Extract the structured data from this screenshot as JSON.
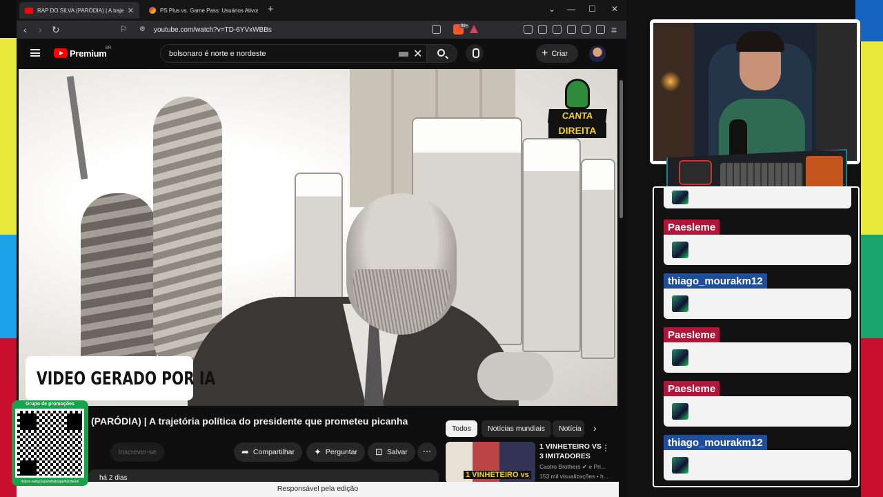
{
  "browser": {
    "tabs": [
      {
        "title": "RAP DO SILVA (PARÓDIA) | A trajetó",
        "active": true
      },
      {
        "title": "PS Plus vs. Game Pass: Usuários Ativos - Goo",
        "active": false
      }
    ],
    "url": "youtube.com/watch?v=TD-6YVxWBBs",
    "extension_badge": "99+",
    "status_text": "Responsável pela edição"
  },
  "youtube": {
    "brand": "Premium",
    "region": "BR",
    "search_query": "bolsonaro é norte e nordeste",
    "create_label": "Criar",
    "video": {
      "caption": "VIDEO GERADO POR IA",
      "badge_line1": "CANTA",
      "badge_line2": "DIREITA",
      "title": "(PARÓDIA) | A trajetória política do presidente que prometeu picanha",
      "subscribe_label": "Inscrever-se",
      "share_label": "Compartilhar",
      "ask_label": "Perguntar",
      "save_label": "Salvar",
      "posted": "há 2 dias"
    },
    "chips": [
      "Todos",
      "Notícias mundiais",
      "Notícia"
    ],
    "recommendation": {
      "thumb_text": "1 VINHETEIRO vs",
      "title": "1 VINHETEIRO VS 3 IMITADORES",
      "channel": "Castro Brothers ✔ e Pri...",
      "views": "153 mil visualizações • h..."
    }
  },
  "qr_overlay": {
    "header": "Grupo de promoções",
    "footer": "/lotore.net/groups/whatsapp/hardware"
  },
  "chat": {
    "messages": [
      {
        "user": "Paesleme",
        "color": "#b0153a"
      },
      {
        "user": "thiago_mourakm12",
        "color": "#1f4e9b"
      },
      {
        "user": "Paesleme",
        "color": "#b0153a"
      },
      {
        "user": "Paesleme",
        "color": "#b0153a"
      },
      {
        "user": "thiago_mourakm12",
        "color": "#1f4e9b"
      }
    ]
  },
  "colors": {
    "accent_red": "#ff0000",
    "chat_red": "#b0153a",
    "chat_blue": "#1f4e9b",
    "qr_green": "#18a24b"
  }
}
